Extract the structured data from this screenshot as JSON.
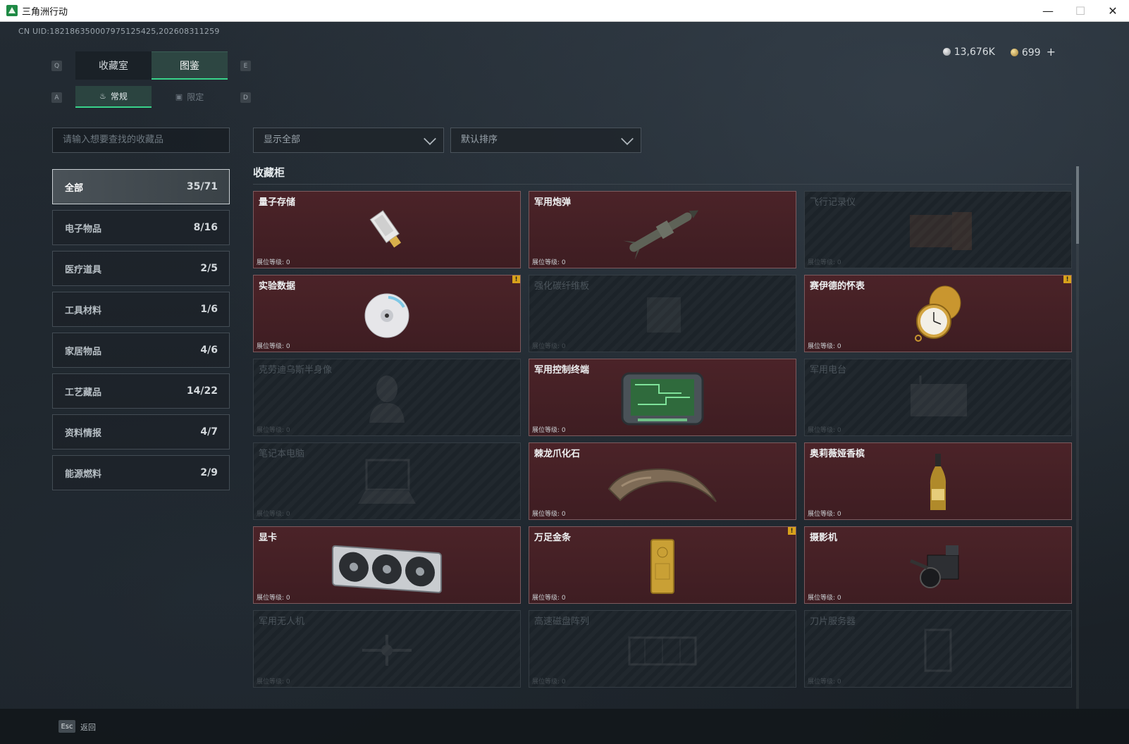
{
  "window": {
    "title": "三角洲行动",
    "minimize": "—",
    "maximize": "☐",
    "close": "✕"
  },
  "header": {
    "uid": "CN UID:182186350007975125425,202608311259",
    "currency_silver": "13,676K",
    "currency_gold": "699",
    "plus": "+"
  },
  "tabs": {
    "key_left": "Q",
    "key_right": "E",
    "items": [
      {
        "label": "收藏室"
      },
      {
        "label": "图鉴"
      }
    ],
    "active": 1
  },
  "subtabs": {
    "key_left": "A",
    "key_right": "D",
    "items": [
      {
        "label": "常规",
        "icon": "flame-icon"
      },
      {
        "label": "限定",
        "icon": "image-icon"
      }
    ],
    "active": 0
  },
  "search": {
    "placeholder": "请输入想要查找的收藏品"
  },
  "filters": {
    "display": "显示全部",
    "sort": "默认排序"
  },
  "categories": [
    {
      "label": "全部",
      "count": "35/71"
    },
    {
      "label": "电子物品",
      "count": "8/16"
    },
    {
      "label": "医疗道具",
      "count": "2/5"
    },
    {
      "label": "工具材料",
      "count": "1/6"
    },
    {
      "label": "家居物品",
      "count": "4/6"
    },
    {
      "label": "工艺藏品",
      "count": "14/22"
    },
    {
      "label": "资料情报",
      "count": "4/7"
    },
    {
      "label": "能源燃料",
      "count": "2/9"
    }
  ],
  "section": {
    "title": "收藏柜"
  },
  "items": [
    {
      "name": "量子存储",
      "level": "展位等级: 0",
      "owned": true,
      "icon": "usb-drive-icon",
      "badge": ""
    },
    {
      "name": "军用炮弹",
      "level": "展位等级: 0",
      "owned": true,
      "icon": "missile-icon",
      "badge": ""
    },
    {
      "name": "飞行记录仪",
      "level": "展位等级: 0",
      "owned": false,
      "icon": "flight-recorder-icon",
      "badge": ""
    },
    {
      "name": "实验数据",
      "level": "展位等级: 0",
      "owned": true,
      "icon": "disc-icon",
      "badge": "!"
    },
    {
      "name": "强化碳纤维板",
      "level": "展位等级: 0",
      "owned": false,
      "icon": "carbon-plate-icon",
      "badge": ""
    },
    {
      "name": "赛伊德的怀表",
      "level": "展位等级: 0",
      "owned": true,
      "icon": "pocket-watch-icon",
      "badge": "!"
    },
    {
      "name": "克劳迪乌斯半身像",
      "level": "展位等级: 0",
      "owned": false,
      "icon": "bust-icon",
      "badge": ""
    },
    {
      "name": "军用控制终端",
      "level": "展位等级: 0",
      "owned": true,
      "icon": "terminal-icon",
      "badge": ""
    },
    {
      "name": "军用电台",
      "level": "展位等级: 0",
      "owned": false,
      "icon": "radio-icon",
      "badge": ""
    },
    {
      "name": "笔记本电脑",
      "level": "展位等级: 0",
      "owned": false,
      "icon": "laptop-icon",
      "badge": ""
    },
    {
      "name": "棘龙爪化石",
      "level": "展位等级: 0",
      "owned": true,
      "icon": "claw-fossil-icon",
      "badge": ""
    },
    {
      "name": "奥莉薇娅香槟",
      "level": "展位等级: 0",
      "owned": true,
      "icon": "champagne-icon",
      "badge": ""
    },
    {
      "name": "显卡",
      "level": "展位等级: 0",
      "owned": true,
      "icon": "gpu-icon",
      "badge": ""
    },
    {
      "name": "万足金条",
      "level": "展位等级: 0",
      "owned": true,
      "icon": "gold-bar-icon",
      "badge": "!"
    },
    {
      "name": "摄影机",
      "level": "展位等级: 0",
      "owned": true,
      "icon": "camera-icon",
      "badge": ""
    },
    {
      "name": "军用无人机",
      "level": "展位等级: 0",
      "owned": false,
      "icon": "drone-icon",
      "badge": ""
    },
    {
      "name": "高速磁盘阵列",
      "level": "展位等级: 0",
      "owned": false,
      "icon": "disk-array-icon",
      "badge": ""
    },
    {
      "name": "刀片服务器",
      "level": "展位等级: 0",
      "owned": false,
      "icon": "blade-server-icon",
      "badge": ""
    }
  ],
  "footer": {
    "esc_key": "Esc",
    "esc_label": "返回"
  },
  "colors": {
    "accent": "#38d38a",
    "owned_card": "#4b2328",
    "badge": "#d8a21b"
  }
}
